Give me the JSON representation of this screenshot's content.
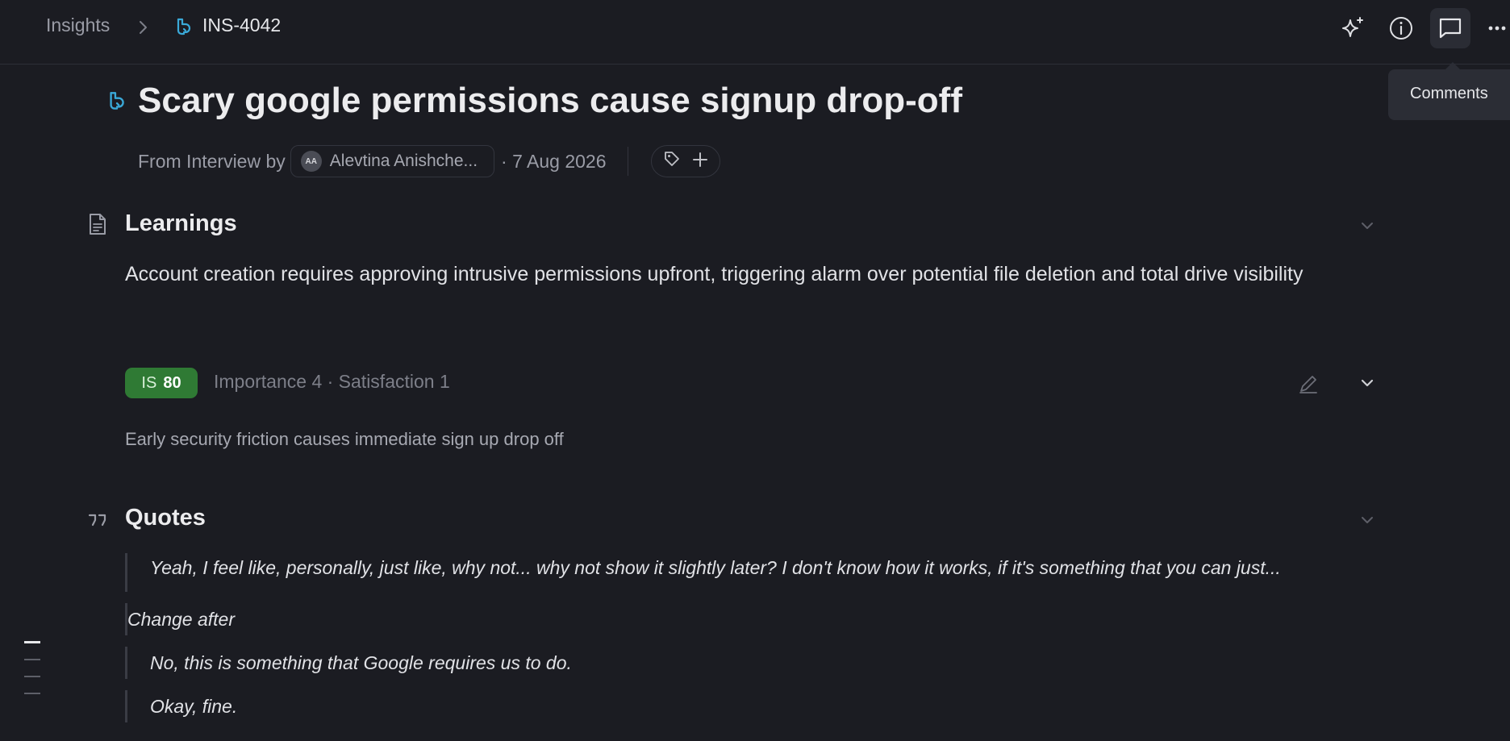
{
  "breadcrumb": {
    "root": "Insights",
    "current": "INS-4042"
  },
  "toolbar": {
    "sparkle_icon": "sparkle-icon",
    "info_icon": "info-icon",
    "comments_icon": "comments-icon",
    "more_icon": "more-icon",
    "tooltip": "Comments"
  },
  "insight": {
    "title": "Scary google permissions cause signup drop-off",
    "source": "From Interview by",
    "author_initials": "AA",
    "author": "Alevtina Anishche...",
    "date": "· 7 Aug 2026"
  },
  "learnings": {
    "heading": "Learnings",
    "text": "Account creation requires approving intrusive permissions upfront, triggering alarm over potential file deletion and total drive visibility",
    "score_label": "IS",
    "score_value": "80",
    "score_meta": "Importance 4 · Satisfaction 1",
    "summary": "Early security friction causes immediate sign up drop off"
  },
  "quotes": {
    "heading": "Quotes",
    "items": [
      " Yeah, I feel like, personally, just like, why not... why not show it slightly later? I don't know how it works, if it's something that you can just...",
      "Change after",
      "No, this is something that Google requires us to do.",
      "Okay, fine."
    ]
  },
  "colors": {
    "background": "#1b1c22",
    "accent_icon": "#3aa9d8",
    "score_badge": "#2f7a34"
  }
}
